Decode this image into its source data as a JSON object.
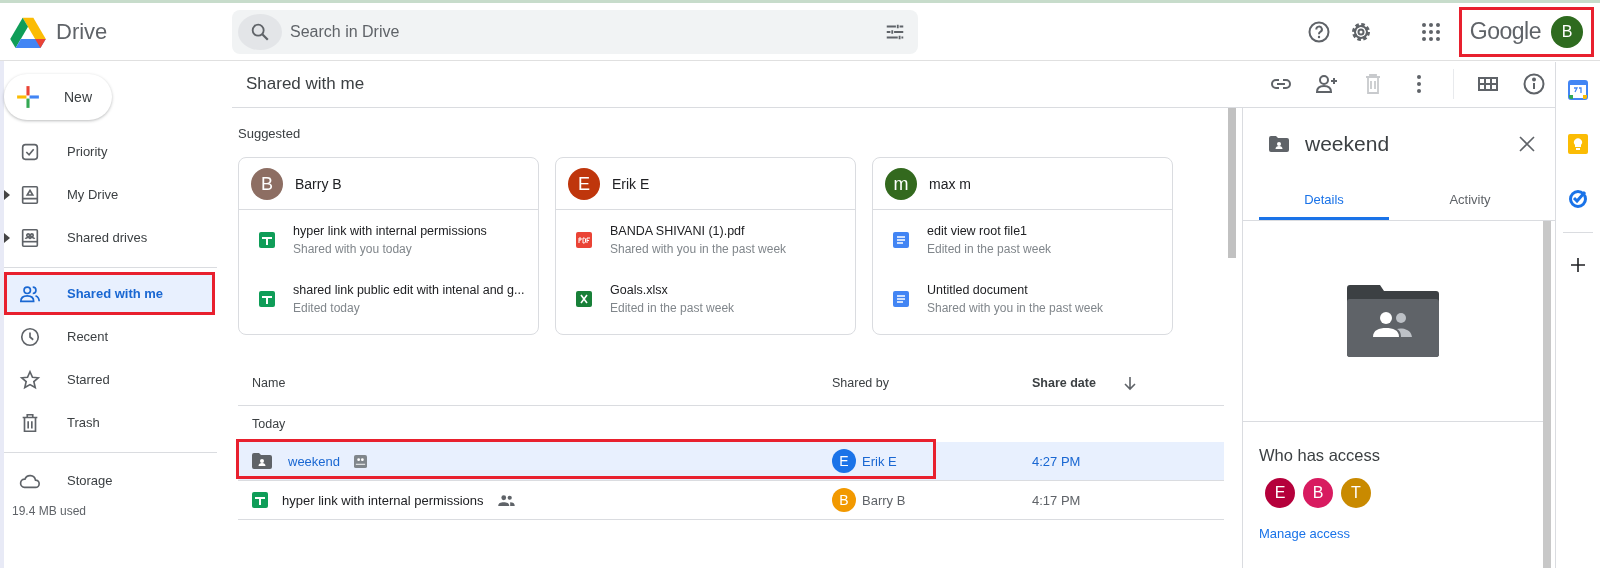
{
  "header": {
    "product": "Drive",
    "search": {
      "placeholder": "Search in Drive"
    },
    "account": {
      "brand": "Google",
      "avatar": "B",
      "color": "#2e6b1f",
      "annotated": true
    }
  },
  "new_button": "New",
  "sidebar": {
    "items": [
      {
        "label": "Priority",
        "selected": false,
        "expandable": false,
        "annotated": false
      },
      {
        "label": "My Drive",
        "selected": false,
        "expandable": true,
        "annotated": false
      },
      {
        "label": "Shared drives",
        "selected": false,
        "expandable": true,
        "annotated": false
      },
      {
        "label": "Shared with me",
        "selected": true,
        "expandable": false,
        "annotated": true
      },
      {
        "label": "Recent",
        "selected": false,
        "expandable": false,
        "annotated": false
      },
      {
        "label": "Starred",
        "selected": false,
        "expandable": false,
        "annotated": false
      },
      {
        "label": "Trash",
        "selected": false,
        "expandable": false,
        "annotated": false
      }
    ],
    "storage": {
      "label": "Storage",
      "used": "19.4 MB used"
    }
  },
  "page_title": "Shared with me",
  "suggested": {
    "title": "Suggested",
    "cards": [
      {
        "person": "Barry B",
        "avatar": "B",
        "color": "#8d6e63",
        "files": [
          {
            "kind": "sheet",
            "name": "hyper link with internal permissions",
            "note": "Shared with you today"
          },
          {
            "kind": "sheet",
            "name": "shared link public edit with intenal and g...",
            "note": "Edited today"
          }
        ]
      },
      {
        "person": "Erik E",
        "avatar": "E",
        "color": "#bf360c",
        "files": [
          {
            "kind": "pdf",
            "name": "BANDA SHIVANI (1).pdf",
            "note": "Shared with you in the past week"
          },
          {
            "kind": "excel",
            "name": "Goals.xlsx",
            "note": "Edited in the past week"
          }
        ]
      },
      {
        "person": "max m",
        "avatar": "m",
        "color": "#33691e",
        "files": [
          {
            "kind": "doc",
            "name": "edit view root file1",
            "note": "Edited in the past week"
          },
          {
            "kind": "doc",
            "name": "Untitled document",
            "note": "Shared with you in the past week"
          }
        ]
      }
    ]
  },
  "table": {
    "columns": [
      "Name",
      "Shared by",
      "Share date"
    ],
    "group": "Today",
    "rows": [
      {
        "kind": "shared-folder",
        "name": "weekend",
        "owner": "Erik E",
        "avatar": "E",
        "color": "#1a73e8",
        "date": "4:27 PM",
        "selected": true,
        "annotated": true
      },
      {
        "kind": "sheet",
        "name": "hyper link with internal permissions",
        "owner": "Barry B",
        "avatar": "B",
        "color": "#f29900",
        "date": "4:17 PM",
        "selected": false,
        "annotated": false
      }
    ]
  },
  "details": {
    "title": "weekend",
    "tabs": [
      {
        "label": "Details",
        "selected": true
      },
      {
        "label": "Activity",
        "selected": false
      }
    ],
    "access_title": "Who has access",
    "people": [
      {
        "initial": "E",
        "color": "#b5003b"
      },
      {
        "initial": "B",
        "color": "#d81b60"
      },
      {
        "initial": "T",
        "color": "#c98a00"
      }
    ],
    "manage": "Manage access"
  }
}
